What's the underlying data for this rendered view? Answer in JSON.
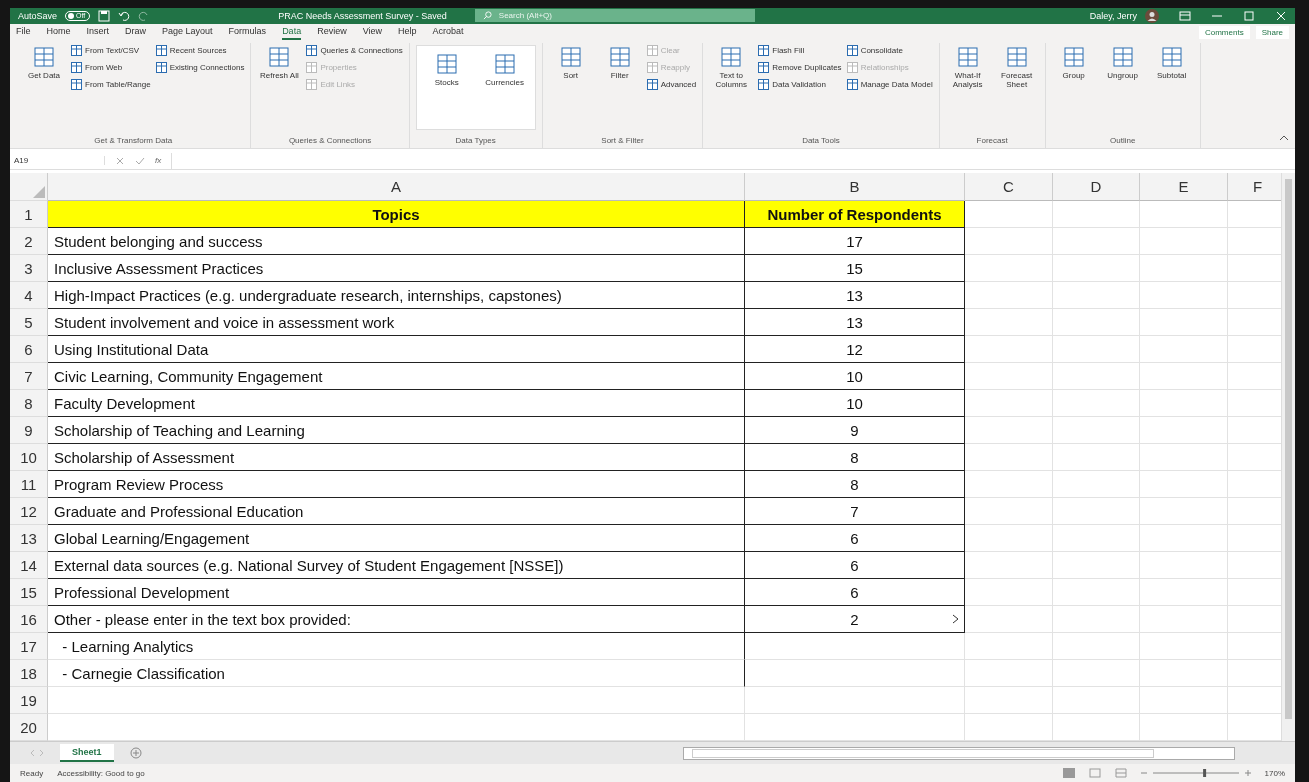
{
  "title_bar": {
    "autosave_label": "AutoSave",
    "autosave_state": "Off",
    "autosave_on": false,
    "title": "PRAC Needs Assessment Survey - Saved",
    "search": {
      "placeholder": "Search (Alt+Q)"
    },
    "user": "Daley, Jerry"
  },
  "tabs": [
    {
      "label": "File",
      "selected": false
    },
    {
      "label": "Home",
      "selected": false
    },
    {
      "label": "Insert",
      "selected": false
    },
    {
      "label": "Draw",
      "selected": false
    },
    {
      "label": "Page Layout",
      "selected": false
    },
    {
      "label": "Formulas",
      "selected": false
    },
    {
      "label": "Data",
      "selected": true
    },
    {
      "label": "Review",
      "selected": false
    },
    {
      "label": "View",
      "selected": false
    },
    {
      "label": "Help",
      "selected": false
    },
    {
      "label": "Acrobat",
      "selected": false
    }
  ],
  "tab_buttons": [
    "Comments",
    "Share"
  ],
  "ribbon": [
    {
      "label": "Get & Transform Data",
      "kind": "plain",
      "items": [
        {
          "label": "Get Data",
          "kind": "large",
          "disabled": false
        },
        {
          "label": "From Text/CSV",
          "kind": "small",
          "disabled": false
        },
        {
          "label": "From Web",
          "kind": "small",
          "disabled": false
        },
        {
          "label": "From Table/Range",
          "kind": "small",
          "disabled": false
        },
        {
          "label": "Recent Sources",
          "kind": "small",
          "disabled": false
        },
        {
          "label": "Existing Connections",
          "kind": "small",
          "disabled": false
        }
      ]
    },
    {
      "label": "Queries & Connections",
      "kind": "plain",
      "items": [
        {
          "label": "Refresh All",
          "kind": "large",
          "disabled": false
        },
        {
          "label": "Queries & Connections",
          "kind": "small",
          "disabled": false
        },
        {
          "label": "Properties",
          "kind": "small",
          "disabled": true
        },
        {
          "label": "Edit Links",
          "kind": "small",
          "disabled": true
        }
      ]
    },
    {
      "label": "Data Types",
      "kind": "gallery",
      "items": [
        {
          "label": "Stocks",
          "kind": "large",
          "disabled": false
        },
        {
          "label": "Currencies",
          "kind": "large",
          "disabled": false
        }
      ]
    },
    {
      "label": "Sort & Filter",
      "kind": "plain",
      "items": [
        {
          "label": "Sort",
          "kind": "large",
          "disabled": false
        },
        {
          "label": "Filter",
          "kind": "large",
          "disabled": false
        },
        {
          "label": "Clear",
          "kind": "small",
          "disabled": true
        },
        {
          "label": "Reapply",
          "kind": "small",
          "disabled": true
        },
        {
          "label": "Advanced",
          "kind": "small",
          "disabled": false
        }
      ]
    },
    {
      "label": "Data Tools",
      "kind": "plain",
      "items": [
        {
          "label": "Text to Columns",
          "kind": "large",
          "disabled": false
        },
        {
          "label": "Flash Fill",
          "kind": "small",
          "disabled": false
        },
        {
          "label": "Remove Duplicates",
          "kind": "small",
          "disabled": false
        },
        {
          "label": "Data Validation",
          "kind": "small",
          "disabled": false
        },
        {
          "label": "Consolidate",
          "kind": "small",
          "disabled": false
        },
        {
          "label": "Relationships",
          "kind": "small",
          "disabled": true
        },
        {
          "label": "Manage Data Model",
          "kind": "small",
          "disabled": false
        }
      ]
    },
    {
      "label": "Forecast",
      "kind": "plain",
      "items": [
        {
          "label": "What-If Analysis",
          "kind": "large",
          "disabled": false
        },
        {
          "label": "Forecast Sheet",
          "kind": "large",
          "disabled": false
        }
      ]
    },
    {
      "label": "Outline",
      "kind": "plain",
      "items": [
        {
          "label": "Group",
          "kind": "large",
          "disabled": false
        },
        {
          "label": "Ungroup",
          "kind": "large",
          "disabled": false
        },
        {
          "label": "Subtotal",
          "kind": "large",
          "disabled": false
        }
      ]
    }
  ],
  "formula_bar": {
    "name_box": "A19",
    "fx": "fx"
  },
  "columns": [
    "A",
    "B",
    "C",
    "D",
    "E",
    "F"
  ],
  "rows": [
    {
      "number": "1",
      "a": "Topics",
      "b": "Number of Respondents",
      "header": true,
      "bordered": true
    },
    {
      "number": "2",
      "a": "Student belonging and success",
      "b": "17",
      "header": false,
      "bordered": true
    },
    {
      "number": "3",
      "a": "Inclusive Assessment Practices",
      "b": "15",
      "header": false,
      "bordered": true
    },
    {
      "number": "4",
      "a": "High-Impact Practices (e.g. undergraduate research, internships, capstones)",
      "b": "13",
      "header": false,
      "bordered": true
    },
    {
      "number": "5",
      "a": "Student involvement and voice in assessment work",
      "b": "13",
      "header": false,
      "bordered": true
    },
    {
      "number": "6",
      "a": "Using Institutional Data",
      "b": "12",
      "header": false,
      "bordered": true
    },
    {
      "number": "7",
      "a": "Civic Learning, Community Engagement",
      "b": "10",
      "header": false,
      "bordered": true
    },
    {
      "number": "8",
      "a": "Faculty Development",
      "b": "10",
      "header": false,
      "bordered": true
    },
    {
      "number": "9",
      "a": "Scholarship of Teaching and Learning",
      "b": "9",
      "header": false,
      "bordered": true
    },
    {
      "number": "10",
      "a": "Scholarship of Assessment",
      "b": "8",
      "header": false,
      "bordered": true
    },
    {
      "number": "11",
      "a": "Program Review Process",
      "b": "8",
      "header": false,
      "bordered": true
    },
    {
      "number": "12",
      "a": "Graduate and Professional Education",
      "b": "7",
      "header": false,
      "bordered": true
    },
    {
      "number": "13",
      "a": "Global Learning/Engagement",
      "b": "6",
      "header": false,
      "bordered": true
    },
    {
      "number": "14",
      "a": "External data sources (e.g. National Survey of Student Engagement [NSSE])",
      "b": "6",
      "header": false,
      "bordered": true
    },
    {
      "number": "15",
      "a": "Professional Development",
      "b": "6",
      "header": false,
      "bordered": true
    },
    {
      "number": "16",
      "a": "Other - please enter in the text box provided:",
      "b": "2",
      "header": false,
      "bordered": true
    },
    {
      "number": "17",
      "a": "  - Learning Analytics",
      "header": false,
      "bordered": false
    },
    {
      "number": "18",
      "a": "  - Carnegie Classification",
      "header": false,
      "bordered": false
    },
    {
      "number": "19",
      "header": false,
      "bordered": false
    },
    {
      "number": "20",
      "header": false,
      "bordered": false
    }
  ],
  "sheet_tabs": [
    {
      "label": "Sheet1",
      "selected": true
    }
  ],
  "status_bar": {
    "mode": "Ready",
    "accessibility": "Accessibility: Good to go",
    "zoom": "170%",
    "zoom_slider": {
      "level": 0.6
    }
  }
}
